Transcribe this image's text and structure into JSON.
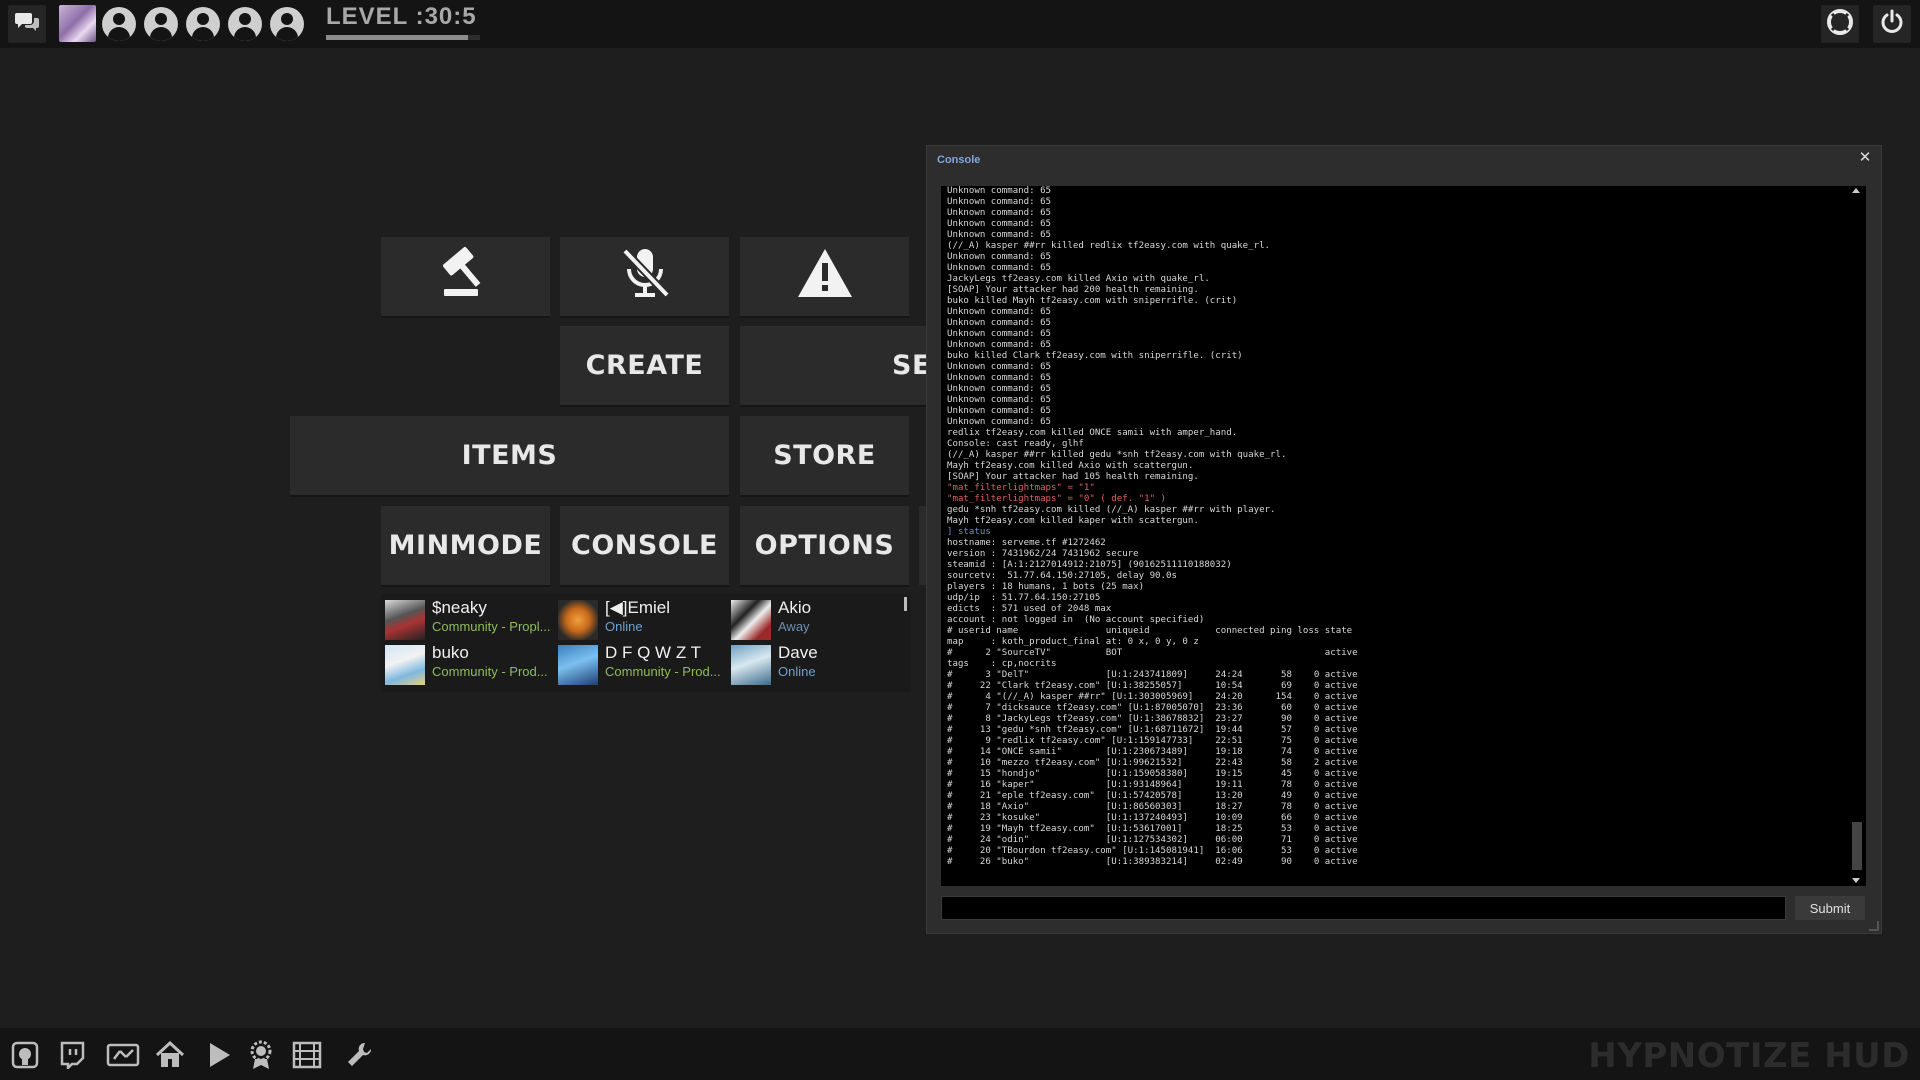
{
  "topbar": {
    "level_text": "LEVEL :30:5",
    "level_progress": 0.92,
    "friend_slots": 5,
    "icons": {
      "chat": "chat-bubbles-icon",
      "achievements": "lifebuoy-icon",
      "power": "power-icon"
    }
  },
  "menu": {
    "create_label": "CREATE",
    "server_label_partial": "SE",
    "items_label": "ITEMS",
    "store_label": "STORE",
    "minmode_label": "MINMODE",
    "console_label": "CONSOLE",
    "options_label": "OPTIONS",
    "icons": {
      "report": "gavel-icon",
      "mute": "muted-microphone-icon",
      "warning": "warning-icon"
    }
  },
  "friends": [
    {
      "name": "$neaky",
      "status": "Community - Propl...",
      "status_color": "#8fbc5a"
    },
    {
      "name": "[◀]Emiel",
      "status": "Online",
      "status_color": "#6fa2d0"
    },
    {
      "name": "Akio",
      "status": "Away",
      "status_color": "#6f8fb0"
    },
    {
      "name": "buko",
      "status": "Community - Prod...",
      "status_color": "#8fbc5a"
    },
    {
      "name": "D F Q W Z T",
      "status": "Community - Prod...",
      "status_color": "#8fbc5a"
    },
    {
      "name": "Dave",
      "status": "Online",
      "status_color": "#6fa2d0"
    }
  ],
  "console": {
    "title": "Console",
    "submit_label": "Submit",
    "input_value": "",
    "lines": [
      {
        "t": "Unknown command: 65"
      },
      {
        "t": "Unknown command: 65"
      },
      {
        "t": "Unknown command: 65"
      },
      {
        "t": "Unknown command: 65"
      },
      {
        "t": "Unknown command: 65"
      },
      {
        "t": "(//_A) kasper ##rr killed redlix tf2easy.com with quake_rl."
      },
      {
        "t": "Unknown command: 65"
      },
      {
        "t": "Unknown command: 65"
      },
      {
        "t": "JackyLegs tf2easy.com killed Axio with quake_rl."
      },
      {
        "t": "[SOAP] Your attacker had 200 health remaining."
      },
      {
        "t": "buko killed Mayh tf2easy.com with sniperrifle. (crit)"
      },
      {
        "t": "Unknown command: 65"
      },
      {
        "t": "Unknown command: 65"
      },
      {
        "t": "Unknown command: 65"
      },
      {
        "t": "Unknown command: 65"
      },
      {
        "t": "buko killed Clark tf2easy.com with sniperrifle. (crit)"
      },
      {
        "t": "Unknown command: 65"
      },
      {
        "t": "Unknown command: 65"
      },
      {
        "t": "Unknown command: 65"
      },
      {
        "t": "Unknown command: 65"
      },
      {
        "t": "Unknown command: 65"
      },
      {
        "t": "Unknown command: 65"
      },
      {
        "t": "redlix tf2easy.com killed ONCE samii with amper_hand."
      },
      {
        "t": "Console: cast ready, glhf"
      },
      {
        "t": "(//_A) kasper ##rr killed gedu *snh tf2easy.com with quake_rl."
      },
      {
        "t": "Mayh tf2easy.com killed Axio with scattergun."
      },
      {
        "t": "[SOAP] Your attacker had 105 health remaining."
      },
      {
        "t": "\"mat_filterlightmaps\" = \"1\"",
        "c": "red"
      },
      {
        "t": "\"mat_filterlightmaps\" = \"0\" ( def. \"1\" )",
        "c": "red"
      },
      {
        "t": "gedu *snh tf2easy.com killed (//_A) kasper ##rr with player."
      },
      {
        "t": "Mayh tf2easy.com killed kaper with scattergun."
      },
      {
        "t": "] status",
        "c": "blue"
      },
      {
        "t": "hostname: serveme.tf #1272462"
      },
      {
        "t": "version : 7431962/24 7431962 secure"
      },
      {
        "t": "steamid : [A:1:2127014912:21075] (90162511110188032)"
      },
      {
        "t": "sourcetv:  51.77.64.150:27105, delay 90.0s"
      },
      {
        "t": "players : 18 humans, 1 bots (25 max)"
      },
      {
        "t": "udp/ip  : 51.77.64.150:27105"
      },
      {
        "t": "edicts  : 571 used of 2048 max"
      },
      {
        "t": "account : not logged in  (No account specified)"
      },
      {
        "t": "# userid name                uniqueid            connected ping loss state"
      },
      {
        "t": "map     : koth_product_final at: 0 x, 0 y, 0 z"
      },
      {
        "t": "#      2 \"SourceTV\"          BOT                                     active"
      },
      {
        "t": "tags    : cp,nocrits"
      },
      {
        "t": "#      3 \"DelT\"              [U:1:243741809]     24:24       58    0 active"
      },
      {
        "t": "#     22 \"Clark tf2easy.com\" [U:1:38255057]      10:54       69    0 active"
      },
      {
        "t": "#      4 \"(//_A) kasper ##rr\" [U:1:303005969]    24:20      154    0 active"
      },
      {
        "t": "#      7 \"dicksauce tf2easy.com\" [U:1:87005070]  23:36       60    0 active"
      },
      {
        "t": "#      8 \"JackyLegs tf2easy.com\" [U:1:38678832]  23:27       90    0 active"
      },
      {
        "t": "#     13 \"gedu *snh tf2easy.com\" [U:1:68711672]  19:44       57    0 active"
      },
      {
        "t": "#      9 \"redlix tf2easy.com\" [U:1:159147733]    22:51       75    0 active"
      },
      {
        "t": "#     14 \"ONCE samii\"        [U:1:230673489]     19:18       74    0 active"
      },
      {
        "t": "#     10 \"mezzo tf2easy.com\" [U:1:99621532]      22:43       58    2 active"
      },
      {
        "t": "#     15 \"hondjo\"            [U:1:159058380]     19:15       45    0 active"
      },
      {
        "t": "#     16 \"kaper\"             [U:1:93148964]      19:11       78    0 active"
      },
      {
        "t": "#     21 \"eple tf2easy.com\"  [U:1:57420578]      13:20       49    0 active"
      },
      {
        "t": "#     18 \"Axio\"              [U:1:86560303]      18:27       78    0 active"
      },
      {
        "t": "#     23 \"kosuke\"            [U:1:137240493]     10:09       66    0 active"
      },
      {
        "t": "#     19 \"Mayh tf2easy.com\"  [U:1:53617001]      18:25       53    0 active"
      },
      {
        "t": "#     24 \"odin\"              [U:1:127534302]     06:00       71    0 active"
      },
      {
        "t": "#     20 \"TBourdon tf2easy.com\" [U:1:145081941]  16:06       53    0 active"
      },
      {
        "t": "#     26 \"buko\"              [U:1:389383214]     02:49       90    0 active"
      }
    ]
  },
  "bottombar": {
    "brand": "HYPNOTIZE HUD",
    "icons": [
      "github-icon",
      "twitch-icon",
      "server-browser-icon",
      "home-icon",
      "play-icon",
      "achievement-ribbon-icon",
      "film-icon",
      "wrench-icon"
    ]
  }
}
